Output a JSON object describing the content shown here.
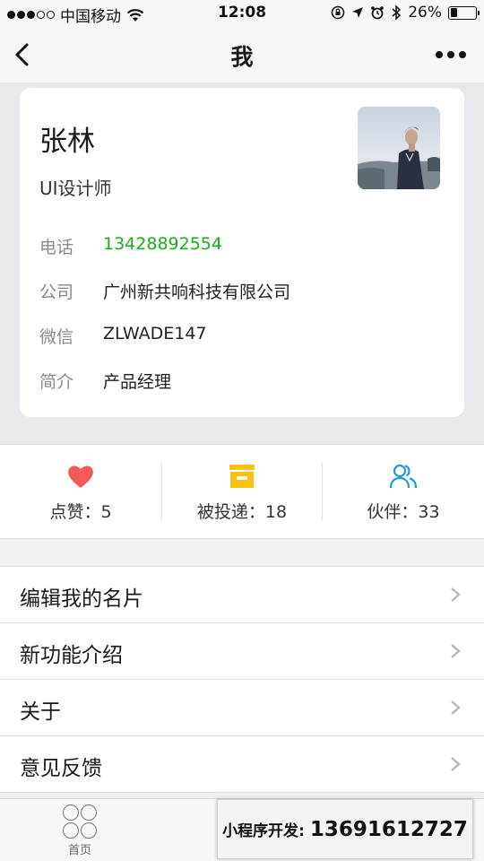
{
  "status_bar": {
    "carrier": "中国移动",
    "time": "12:08",
    "battery": "26%",
    "battery_level": 0.26
  },
  "nav": {
    "title": "我"
  },
  "profile": {
    "name": "张林",
    "title": "UI设计师",
    "fields": [
      {
        "label": "电话",
        "value": "13428892554"
      },
      {
        "label": "公司",
        "value": "广州新共响科技有限公司"
      },
      {
        "label": "微信",
        "value": "ZLWADE147"
      },
      {
        "label": "简介",
        "value": "产品经理"
      }
    ]
  },
  "stats": [
    {
      "label": "点赞：5",
      "icon": "heart-icon",
      "color": "#f25a5a"
    },
    {
      "label": "被投递：18",
      "icon": "box-icon",
      "color": "#f9c20f"
    },
    {
      "label": "伙伴：33",
      "icon": "people-icon",
      "color": "#1e9ae0"
    }
  ],
  "menu": [
    {
      "label": "编辑我的名片"
    },
    {
      "label": "新功能介绍"
    },
    {
      "label": "关于"
    },
    {
      "label": "意见反馈"
    }
  ],
  "tabbar": {
    "home_label": "首页"
  },
  "promo": {
    "label": "小程序开发:",
    "phone": "13691612727"
  },
  "colors": {
    "accent_green": "#1aad19",
    "background": "#efeff4"
  }
}
